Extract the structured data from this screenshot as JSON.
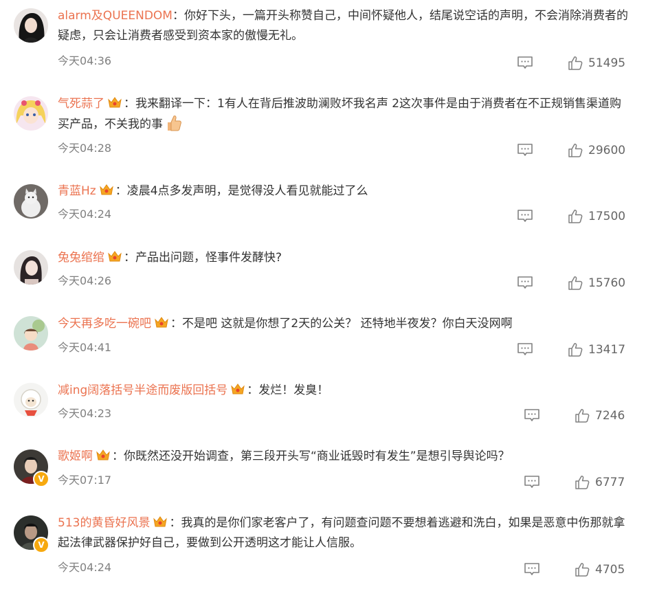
{
  "comments": [
    {
      "user": "alarm及QUEENDOM",
      "separator": "：",
      "text": "你好下头，一篇开头称赞自己，中间怀疑他人，结尾说空话的声明，不会消除消费者的疑虑，只会让消费者感受到资本家的傲慢无礼。",
      "time": "今天04:36",
      "likes": "51495",
      "has_crown": false,
      "has_v": false,
      "avatar_icon": "avatar-woman-dark-hair-icon"
    },
    {
      "user": "气死蒜了",
      "separator": "：",
      "text": "我来翻译一下：1有人在背后推波助澜败坏我名声 2这次事件是由于消费者在不正规销售渠道购买产品，不关我的事",
      "time": "今天04:28",
      "likes": "29600",
      "has_crown": true,
      "has_v": false,
      "avatar_icon": "avatar-anime-girl-icon",
      "emoji": "thumbs-up-emoji-icon"
    },
    {
      "user": "青蓝Hz",
      "separator": "：",
      "text": "凌晨4点多发声明，是觉得没人看见就能过了么",
      "time": "今天04:24",
      "likes": "17500",
      "has_crown": true,
      "has_v": false,
      "avatar_icon": "avatar-cat-icon"
    },
    {
      "user": "兔兔绾绾",
      "separator": "：",
      "text": "产品出问题，怪事件发酵快?",
      "time": "今天04:26",
      "likes": "15760",
      "has_crown": true,
      "has_v": false,
      "avatar_icon": "avatar-woman-photo-icon"
    },
    {
      "user": "今天再多吃一碗吧",
      "separator": "：",
      "text": "不是吧 这就是你想了2天的公关？ 还特地半夜发？你白天没网啊",
      "time": "今天04:41",
      "likes": "13417",
      "has_crown": true,
      "has_v": false,
      "avatar_icon": "avatar-illustration-girl-icon"
    },
    {
      "user": "减ing阔落括号半途而废版回括号",
      "separator": "：",
      "text": "发烂！发臭！",
      "time": "今天04:23",
      "likes": "7246",
      "has_crown": true,
      "has_v": false,
      "avatar_icon": "avatar-sheep-cartoon-icon"
    },
    {
      "user": "歌姬啊",
      "separator": "：",
      "text": "你既然还没开始调查，第三段开头写“商业诋毁时有发生”是想引导舆论吗？",
      "time": "今天07:17",
      "likes": "6777",
      "has_crown": true,
      "has_v": true,
      "avatar_icon": "avatar-man-costume-icon"
    },
    {
      "user": "513的黄昏好风景",
      "separator": "：",
      "text": "我真的是你们家老客户了，有问题查问题不要想着逃避和洗白，如果是恶意中伤那就拿起法律武器保护好自己，要做到公开透明这才能让人信服。",
      "time": "今天04:24",
      "likes": "4705",
      "has_crown": true,
      "has_v": true,
      "avatar_icon": "avatar-man-dark-icon"
    }
  ],
  "icons": {
    "reply": "comment-reply-icon",
    "like": "thumbs-up-like-icon",
    "crown": "vip-crown-badge-icon",
    "verified": "verified-v-badge-icon"
  },
  "colors": {
    "username": "#eb7350",
    "text": "#333333",
    "time": "#808080",
    "icon": "#808080",
    "crown": "#f5a623",
    "verified": "#f7a90f"
  },
  "verified_label": "V"
}
